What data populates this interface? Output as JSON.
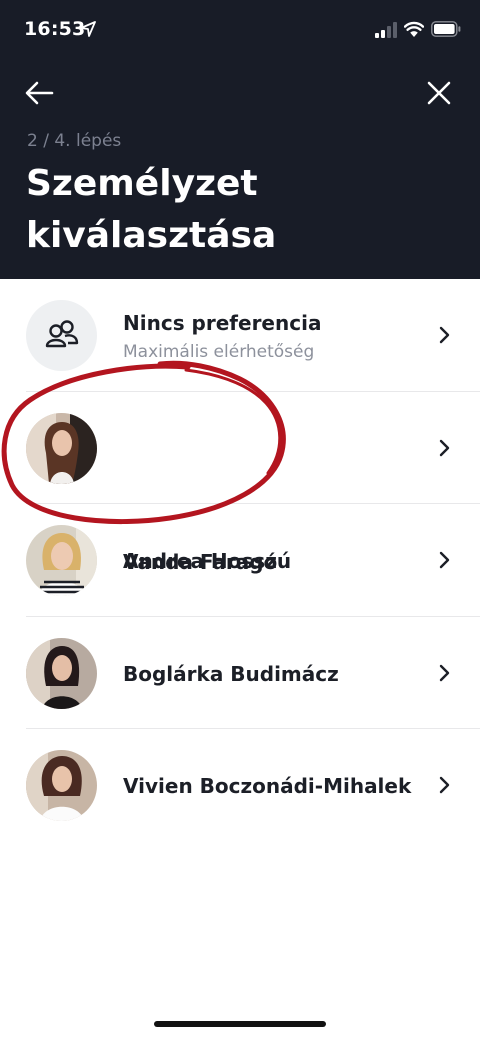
{
  "status_bar": {
    "time": "16:53"
  },
  "header": {
    "step": "2 / 4. lépés",
    "title": "Személyzet kiválasztása"
  },
  "staff": [
    {
      "name": "Nincs preferencia",
      "subtitle": "Maximális elérhetőség",
      "icon": "users-icon"
    },
    {
      "name": "Vanda Faragó"
    },
    {
      "name": "Andrea Hosszú"
    },
    {
      "name": "Boglárka Budimácz"
    },
    {
      "name": "Vivien Boczonádi-Mihalek"
    }
  ],
  "colors": {
    "header_bg": "#181c27",
    "annotation_red": "#b3151f",
    "text_primary": "#1c1f27",
    "text_secondary": "#8d919c"
  }
}
